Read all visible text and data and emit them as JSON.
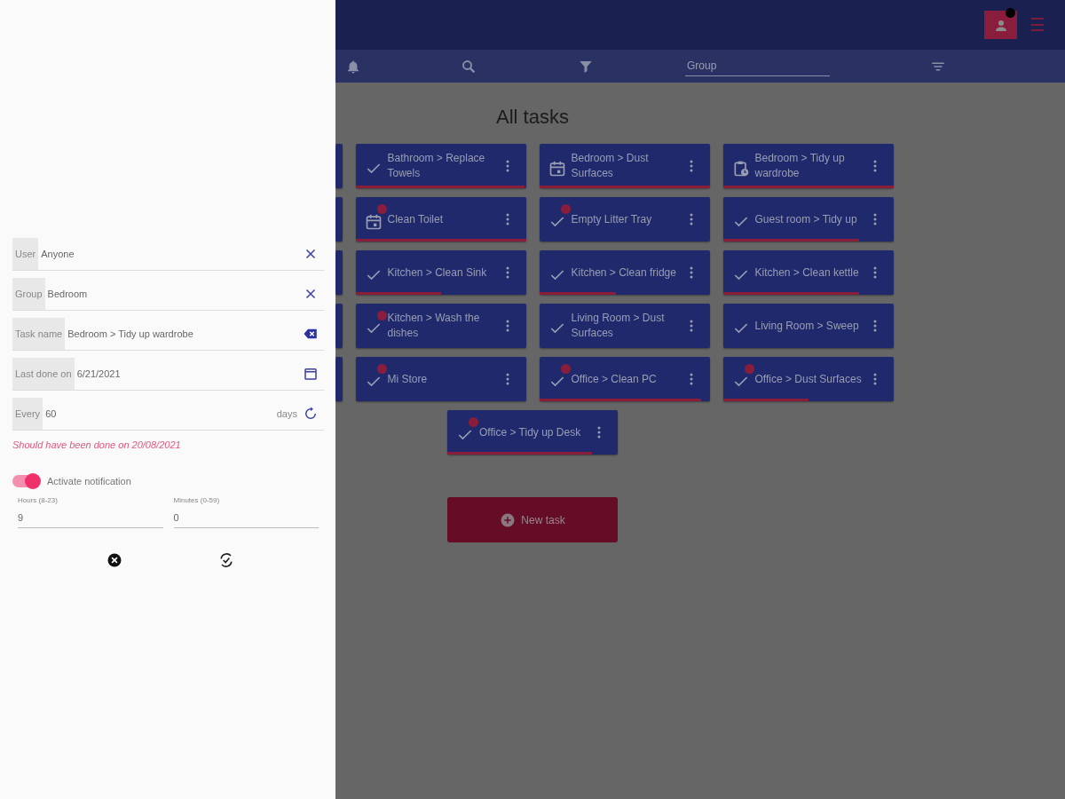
{
  "top_bar": {
    "menu": "☰"
  },
  "toolbar": {
    "group_placeholder": "Group"
  },
  "title": "All tasks",
  "covered_cards": [
    {
      "kind": "card"
    },
    {
      "kind": "card"
    },
    {
      "kind": "card"
    },
    {
      "kind": "card"
    },
    {
      "kind": "card"
    }
  ],
  "tasks": [
    {
      "name": "Bathroom > Replace Towels",
      "kind": "check",
      "assigned": false,
      "level": 0.99
    },
    {
      "name": "Bedroom > Dust Surfaces",
      "kind": "calendar",
      "assigned": false,
      "level": 1
    },
    {
      "name": "Bedroom > Tidy up wardrobe",
      "kind": "clipboard",
      "assigned": false,
      "level": 1
    },
    {
      "name": "Clean Toilet",
      "kind": "calendar",
      "assigned": true,
      "level": 1
    },
    {
      "name": "Empty Litter Tray",
      "kind": "check",
      "assigned": true,
      "level": 0
    },
    {
      "name": "Guest room > Tidy up",
      "kind": "check",
      "assigned": false,
      "level": 0.8
    },
    {
      "name": "Kitchen > Clean Sink",
      "kind": "check",
      "assigned": false,
      "level": 0.5
    },
    {
      "name": "Kitchen > Clean fridge",
      "kind": "check",
      "assigned": false,
      "level": 0.45
    },
    {
      "name": "Kitchen > Clean kettle",
      "kind": "check",
      "assigned": false,
      "level": 0.8
    },
    {
      "name": "Kitchen > Wash the dishes",
      "kind": "check",
      "assigned": true,
      "level": 0
    },
    {
      "name": "Living Room > Dust Surfaces",
      "kind": "check",
      "assigned": false,
      "level": 0
    },
    {
      "name": "Living Room > Sweep",
      "kind": "check",
      "assigned": false,
      "level": 0
    },
    {
      "name": "Mi Store",
      "kind": "check",
      "assigned": true,
      "level": 0
    },
    {
      "name": "Office > Clean PC",
      "kind": "check",
      "assigned": true,
      "level": 0.95
    },
    {
      "name": "Office > Dust Surfaces",
      "kind": "check",
      "assigned": true,
      "level": 0.5
    },
    {
      "name": "Office > Tidy up Desk",
      "kind": "check",
      "assigned": true,
      "level": 0.85
    }
  ],
  "new_task": "New task",
  "drawer": {
    "fields": [
      {
        "label": "User",
        "value": "Anyone",
        "kind": "clear"
      },
      {
        "label": "Group",
        "value": "Bedroom",
        "kind": "clear"
      },
      {
        "label": "Task name",
        "value": "Bedroom > Tidy up wardrobe",
        "kind": "backspace"
      },
      {
        "label": "Last done on",
        "value": "6/21/2021",
        "kind": "date"
      },
      {
        "label": "Every",
        "value": "60",
        "unit": "days",
        "kind": "repeat"
      }
    ],
    "due_warning": "Should have been done on 20/08/2021",
    "notification": {
      "label": "Activate notification",
      "on": true
    },
    "hours": {
      "label": "Hours (8-23)",
      "value": "9"
    },
    "minutes": {
      "label": "Minutes (0-59)",
      "value": "0"
    }
  }
}
